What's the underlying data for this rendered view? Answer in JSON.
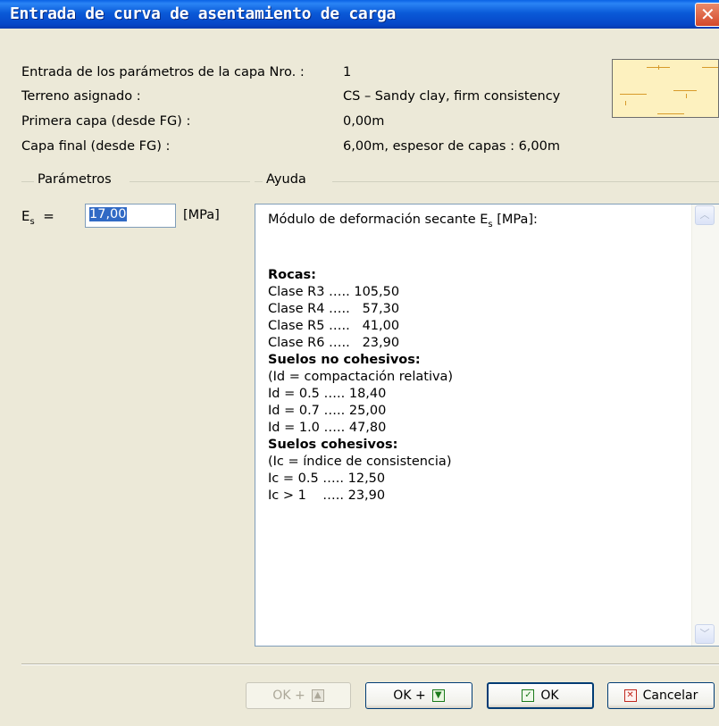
{
  "window": {
    "title": "Entrada de curva de asentamiento de carga",
    "close_glyph": "✕"
  },
  "info": {
    "rows": [
      {
        "label": "Entrada de los parámetros de la capa Nro. :",
        "value": "1"
      },
      {
        "label": "Terreno asignado :",
        "value": "CS – Sandy clay, firm consistency"
      },
      {
        "label": "Primera capa (desde FG) :",
        "value": "0,00m"
      },
      {
        "label": "Capa final (desde FG) :",
        "value": "6,00m, espesor de capas : 6,00m"
      }
    ]
  },
  "params": {
    "group_label": "Parámetros",
    "es_label": "E",
    "es_sub": "s",
    "es_eq": "=",
    "es_value": "17,00",
    "unit": "[MPa]"
  },
  "help": {
    "group_label": "Ayuda",
    "heading_pre": "Módulo de deformación secante E",
    "heading_sub": "s",
    "heading_post": " [MPa]:",
    "rocas_title": "Rocas:",
    "rocas": [
      "Clase R3 ….. 105,50",
      "Clase R4 …..   57,30",
      "Clase R5 …..   41,00",
      "Clase R6 …..   23,90"
    ],
    "nc_title": "Suelos no cohesivos:",
    "nc": [
      "(Id = compactación relativa)",
      "Id = 0.5 ….. 18,40",
      "Id = 0.7 ….. 25,00",
      "Id = 1.0 ….. 47,80"
    ],
    "c_title": "Suelos cohesivos:",
    "c": [
      "(Ic = índice de consistencia)",
      "Ic = 0.5 ….. 12,50",
      "Ic > 1    ….. 23,90"
    ]
  },
  "buttons": {
    "ok_up": "OK +",
    "ok_down": "OK +",
    "ok": "OK",
    "cancel": "Cancelar"
  },
  "icons": {
    "up": "▲",
    "down": "▼",
    "check": "✓",
    "cancel": "✕",
    "scroll_up": "︿",
    "scroll_down": "﹀"
  }
}
